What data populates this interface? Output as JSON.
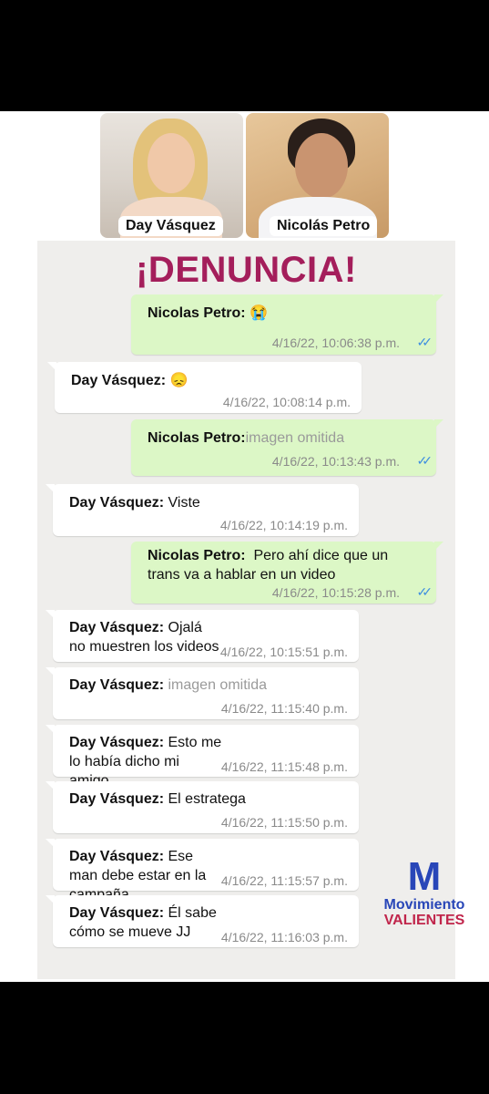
{
  "header": {
    "left_name": "Day Vásquez",
    "right_name": "Nicolás Petro"
  },
  "title": "¡DENUNCIA!",
  "messages": [
    {
      "sender": "Nicolas Petro:",
      "text": "😭",
      "time": "4/16/22, 10:06:38 p.m."
    },
    {
      "sender": "Day Vásquez:",
      "text": "😞",
      "time": "4/16/22, 10:08:14 p.m."
    },
    {
      "sender": "Nicolas Petro:",
      "text": "imagen omitida",
      "time": "4/16/22, 10:13:43 p.m."
    },
    {
      "sender": "Day Vásquez:",
      "text": "Viste",
      "time": "4/16/22, 10:14:19 p.m."
    },
    {
      "sender": "Nicolas Petro:",
      "text": "Pero ahí dice que un trans va a hablar en un video",
      "time": "4/16/22, 10:15:28 p.m."
    },
    {
      "sender": "Day Vásquez:",
      "text": "Ojalá no muestren los videos",
      "time": "4/16/22, 10:15:51 p.m."
    },
    {
      "sender": "Day Vásquez:",
      "text": "imagen omitida",
      "time": "4/16/22, 11:15:40 p.m."
    },
    {
      "sender": "Day Vásquez:",
      "text": "Esto me lo había dicho mi amigo",
      "time": "4/16/22, 11:15:48 p.m."
    },
    {
      "sender": "Day Vásquez:",
      "text": "El estratega",
      "time": "4/16/22, 11:15:50 p.m."
    },
    {
      "sender": "Day Vásquez:",
      "text": "Ese man debe estar en la campaña",
      "time": "4/16/22, 11:15:57 p.m."
    },
    {
      "sender": "Day Vásquez:",
      "text": "Él sabe cómo se mueve JJ",
      "time": "4/16/22, 11:16:03 p.m."
    }
  ],
  "logo": {
    "letter": "M",
    "line1": "Movimiento",
    "line2": "VALIENTES"
  },
  "colors": {
    "title": "#a41e5b",
    "outgoing_bubble": "#dcf7c6",
    "incoming_bubble": "#ffffff",
    "read_ticks": "#3f8fe0",
    "logo_blue": "#2846b8",
    "logo_red": "#c0254b"
  }
}
